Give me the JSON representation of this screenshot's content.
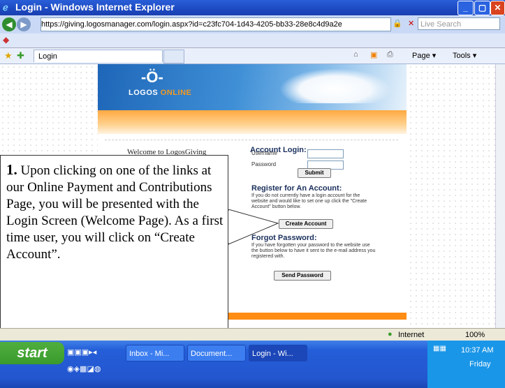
{
  "window": {
    "title": "Login - Windows Internet Explorer"
  },
  "address": {
    "url": "https://giving.logosmanager.com/login.aspx?id=c23fc704-1d43-4205-bb33-28e8c4d9a2e",
    "search_placeholder": "Live Search"
  },
  "tab": {
    "label": "Login"
  },
  "toolbar": {
    "page_label": "Page ▾",
    "tools_label": "Tools ▾"
  },
  "page": {
    "logo": {
      "brand": "LOGOS",
      "brand_accent": " ONLINE"
    },
    "welcome": "Welcome to LogosGiving",
    "account_login": {
      "title": "Account Login:",
      "username_label": "Username",
      "password_label": "Password",
      "submit": "Submit"
    },
    "register": {
      "title": "Register for An Account:",
      "text": "If you do not currently have a login account for the website and would like to set one up click the \"Create Account\" button below.",
      "button": "Create Account"
    },
    "forgot": {
      "title": "Forgot Password:",
      "text": "If you have forgotten your password to the website use the button below to have it sent to the e-mail address you registered with.",
      "button": "Send Password"
    }
  },
  "callout": {
    "number": "1.",
    "text": " Upon clicking on one of the links at our Online Payment and Contributions Page, you will be presented with the Login Screen (Welcome Page).  As a first time user, you will click on “Create Account”."
  },
  "status": {
    "zone": "Internet",
    "zoom": "100%"
  },
  "taskbar": {
    "start": "start",
    "tasks": [
      "Inbox - Mi...",
      "Document...",
      "Login - Wi..."
    ],
    "time": "10:37 AM",
    "day": "Friday"
  }
}
